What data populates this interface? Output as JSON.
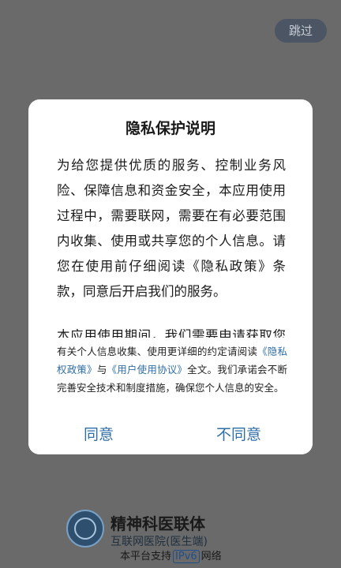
{
  "skip_button": {
    "label": "跳过"
  },
  "dialog": {
    "title": "隐私保护说明",
    "paragraph_1": "为给您提供优质的服务、控制业务风险、保障信息和资金安全，本应用使用过程中，需要联网，需要在有必要范围内收集、使用或共享您的个人信息。请您在使用前仔细阅读《隐私政策》条款，同意后开启我们的服务。",
    "paragraph_2": "本应用使用期间，我们需要申请获取您的系统权限，我们将在首次调用时逐项",
    "notice": {
      "text_before": "有关个人信息收集、使用更详细的约定请阅读",
      "privacy_link": "《隐私权政策》",
      "connector": "与",
      "terms_link": "《用户使用协议》",
      "text_after": "全文。我们承诺会不断完善安全技术和制度措施，确保您个人信息的安全。"
    },
    "agree_label": "同意",
    "disagree_label": "不同意"
  },
  "brand": {
    "name": "精神科医联体",
    "subtitle": "互联网医院(医生端)",
    "support_prefix": "本平台支持",
    "ipv6_badge": "IPv6",
    "support_suffix": "网络"
  }
}
